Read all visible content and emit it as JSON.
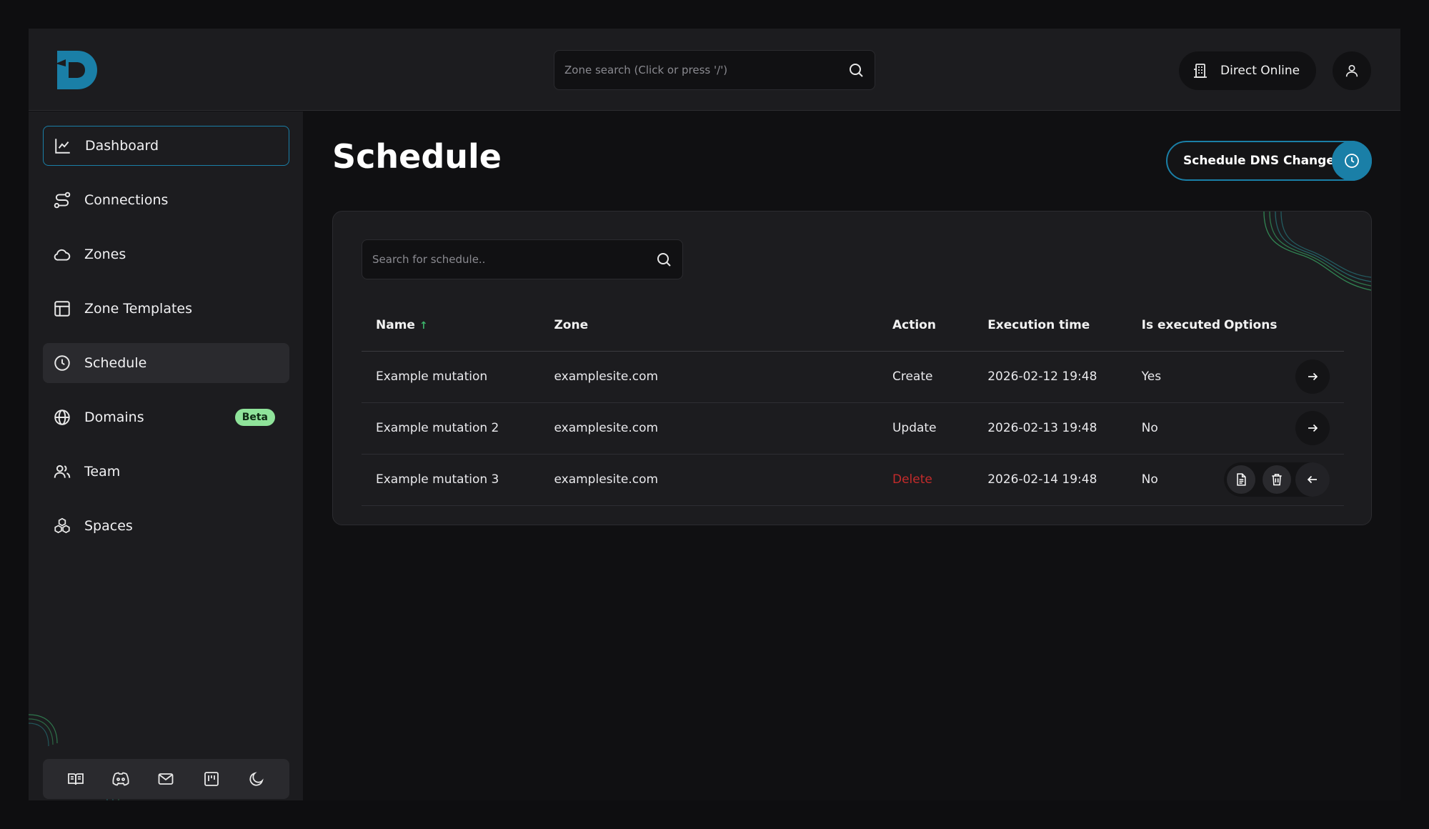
{
  "header": {
    "zone_search_placeholder": "Zone search (Click or press '/')",
    "org_name": "Direct Online"
  },
  "sidebar": {
    "items": [
      {
        "label": "Dashboard",
        "icon": "chart-line-icon"
      },
      {
        "label": "Connections",
        "icon": "route-icon"
      },
      {
        "label": "Zones",
        "icon": "cloud-icon"
      },
      {
        "label": "Zone Templates",
        "icon": "layout-icon"
      },
      {
        "label": "Schedule",
        "icon": "clock-icon"
      },
      {
        "label": "Domains",
        "icon": "globe-icon",
        "badge": "Beta"
      },
      {
        "label": "Team",
        "icon": "users-icon"
      },
      {
        "label": "Spaces",
        "icon": "boxes-icon"
      }
    ],
    "footer_icons": [
      "book-icon",
      "discord-icon",
      "mail-icon",
      "kanban-icon",
      "moon-icon"
    ]
  },
  "main": {
    "title": "Schedule",
    "schedule_button": "Schedule DNS Change",
    "search_placeholder": "Search for schedule..",
    "table": {
      "columns": [
        "Name",
        "Zone",
        "Action",
        "Execution time",
        "Is executed",
        "Options"
      ],
      "rows": [
        {
          "name": "Example mutation",
          "zone": "examplesite.com",
          "action": "Create",
          "time": "2026-02-12 19:48",
          "executed": "Yes"
        },
        {
          "name": "Example mutation 2",
          "zone": "examplesite.com",
          "action": "Update",
          "time": "2026-02-13 19:48",
          "executed": "No"
        },
        {
          "name": "Example mutation 3",
          "zone": "examplesite.com",
          "action": "Delete",
          "time": "2026-02-14 19:48",
          "executed": "No"
        }
      ]
    }
  },
  "colors": {
    "accent": "#1a7fa7",
    "badge": "#8fe39a",
    "delete": "#c42b2b",
    "sort": "#3bb26a"
  }
}
